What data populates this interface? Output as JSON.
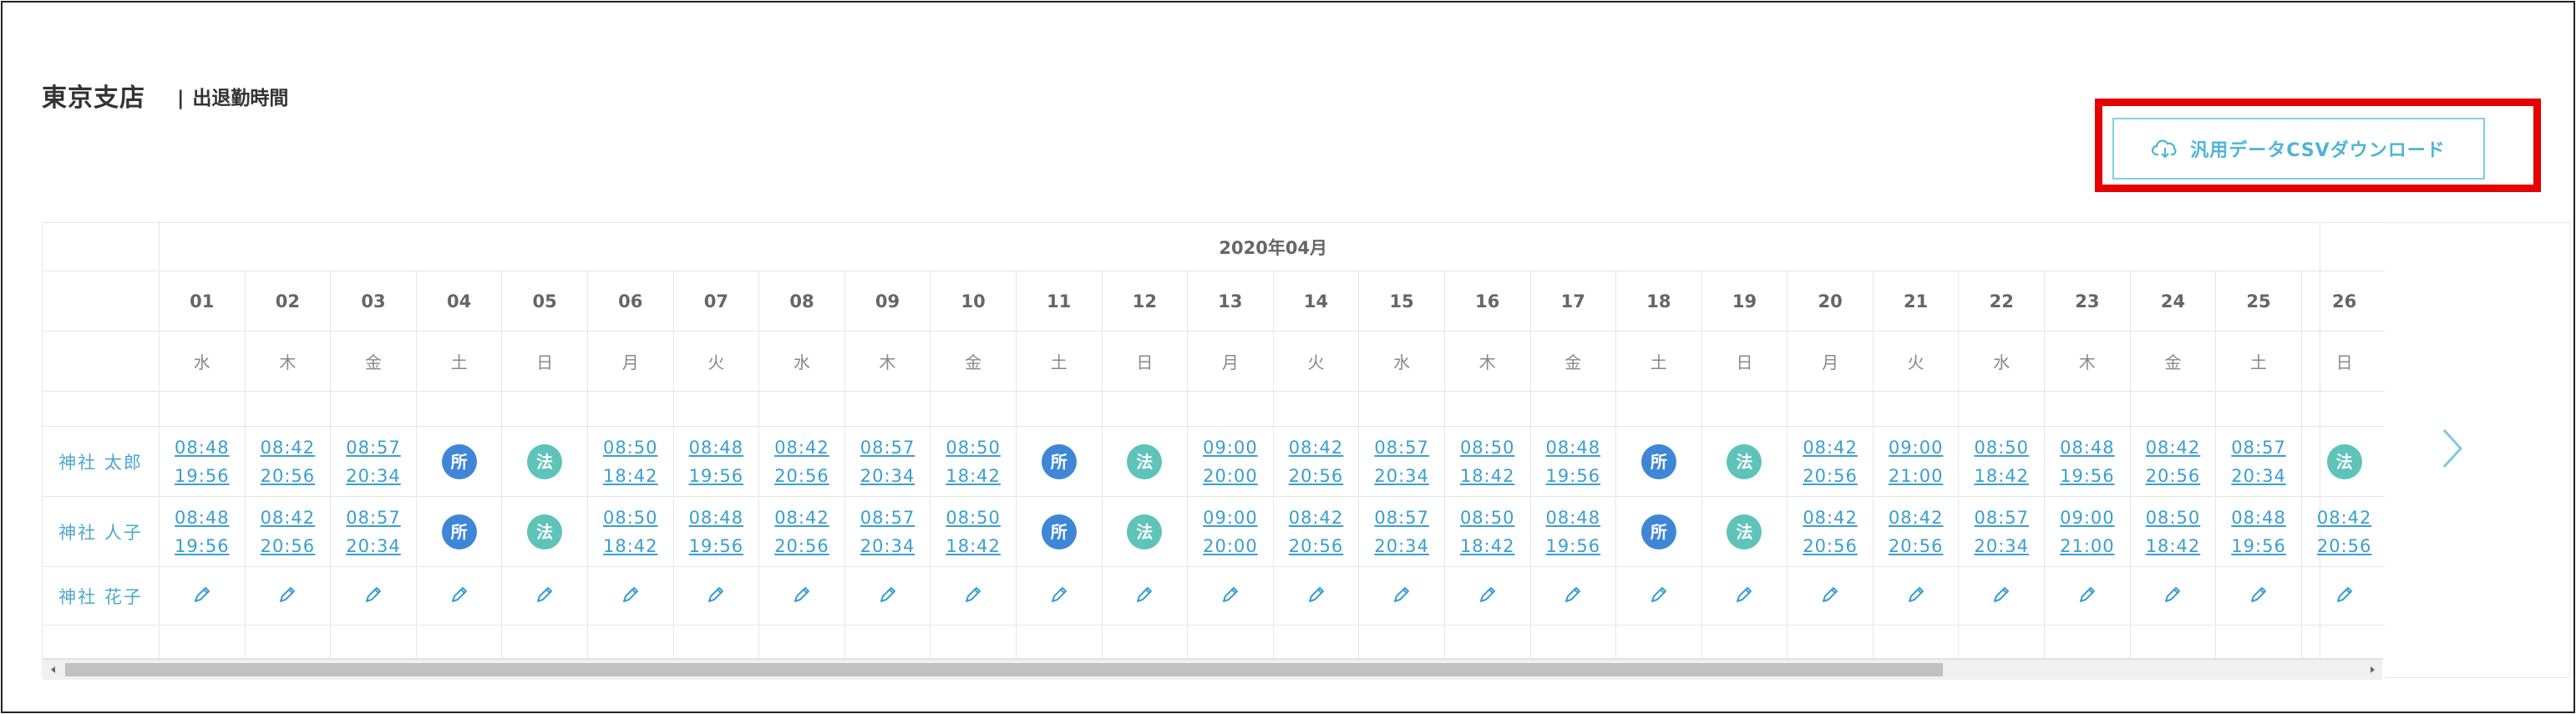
{
  "header": {
    "branch_title": "東京支店",
    "separator": "|",
    "section_title": "出退勤時間"
  },
  "csv_button": {
    "label": "汎用データCSVダウンロード",
    "icon": "cloud-download-icon"
  },
  "calendar": {
    "month_label": "2020年04月",
    "dates": [
      "01",
      "02",
      "03",
      "04",
      "05",
      "06",
      "07",
      "08",
      "09",
      "10",
      "11",
      "12",
      "13",
      "14",
      "15",
      "16",
      "17",
      "18",
      "19",
      "20",
      "21",
      "22",
      "23",
      "24",
      "25",
      "26"
    ],
    "weekdays": [
      "水",
      "木",
      "金",
      "土",
      "日",
      "月",
      "火",
      "水",
      "木",
      "金",
      "土",
      "日",
      "月",
      "火",
      "水",
      "木",
      "金",
      "土",
      "日",
      "月",
      "火",
      "水",
      "木",
      "金",
      "土",
      "日"
    ],
    "employees": [
      {
        "name": "神社 太郎",
        "cells": [
          {
            "in": "08:48",
            "out": "19:56"
          },
          {
            "in": "08:42",
            "out": "20:56"
          },
          {
            "in": "08:57",
            "out": "20:34"
          },
          {
            "badge": "所",
            "kind": "sho"
          },
          {
            "badge": "法",
            "kind": "ho"
          },
          {
            "in": "08:50",
            "out": "18:42"
          },
          {
            "in": "08:48",
            "out": "19:56"
          },
          {
            "in": "08:42",
            "out": "20:56"
          },
          {
            "in": "08:57",
            "out": "20:34"
          },
          {
            "in": "08:50",
            "out": "18:42"
          },
          {
            "badge": "所",
            "kind": "sho"
          },
          {
            "badge": "法",
            "kind": "ho"
          },
          {
            "in": "09:00",
            "out": "20:00"
          },
          {
            "in": "08:42",
            "out": "20:56"
          },
          {
            "in": "08:57",
            "out": "20:34"
          },
          {
            "in": "08:50",
            "out": "18:42"
          },
          {
            "in": "08:48",
            "out": "19:56"
          },
          {
            "badge": "所",
            "kind": "sho"
          },
          {
            "badge": "法",
            "kind": "ho"
          },
          {
            "in": "08:42",
            "out": "20:56"
          },
          {
            "in": "09:00",
            "out": "21:00"
          },
          {
            "in": "08:50",
            "out": "18:42"
          },
          {
            "in": "08:48",
            "out": "19:56"
          },
          {
            "in": "08:42",
            "out": "20:56"
          },
          {
            "in": "08:57",
            "out": "20:34"
          },
          {
            "badge": "法",
            "kind": "ho"
          }
        ]
      },
      {
        "name": "神社 人子",
        "cells": [
          {
            "in": "08:48",
            "out": "19:56"
          },
          {
            "in": "08:42",
            "out": "20:56"
          },
          {
            "in": "08:57",
            "out": "20:34"
          },
          {
            "badge": "所",
            "kind": "sho"
          },
          {
            "badge": "法",
            "kind": "ho"
          },
          {
            "in": "08:50",
            "out": "18:42"
          },
          {
            "in": "08:48",
            "out": "19:56"
          },
          {
            "in": "08:42",
            "out": "20:56"
          },
          {
            "in": "08:57",
            "out": "20:34"
          },
          {
            "in": "08:50",
            "out": "18:42"
          },
          {
            "badge": "所",
            "kind": "sho"
          },
          {
            "badge": "法",
            "kind": "ho"
          },
          {
            "in": "09:00",
            "out": "20:00"
          },
          {
            "in": "08:42",
            "out": "20:56"
          },
          {
            "in": "08:57",
            "out": "20:34"
          },
          {
            "in": "08:50",
            "out": "18:42"
          },
          {
            "in": "08:48",
            "out": "19:56"
          },
          {
            "badge": "所",
            "kind": "sho"
          },
          {
            "badge": "法",
            "kind": "ho"
          },
          {
            "in": "08:42",
            "out": "20:56"
          },
          {
            "in": "08:42",
            "out": "20:56"
          },
          {
            "in": "08:57",
            "out": "20:34"
          },
          {
            "in": "09:00",
            "out": "21:00"
          },
          {
            "in": "08:50",
            "out": "18:42"
          },
          {
            "in": "08:48",
            "out": "19:56"
          },
          {
            "in": "08:42",
            "out": "20:56"
          }
        ]
      },
      {
        "name": "神社 花子",
        "cells": "edit-icons"
      }
    ]
  },
  "icons": {
    "edit": "pencil-edit-icon",
    "next": "chevron-right-icon",
    "scroll_left": "triangle-left-icon",
    "scroll_right": "triangle-right-icon"
  },
  "colors": {
    "highlight": "#e60000",
    "link": "#3a9fd0",
    "badge_sho": "#3f86d6",
    "badge_ho": "#5ec3b8"
  }
}
